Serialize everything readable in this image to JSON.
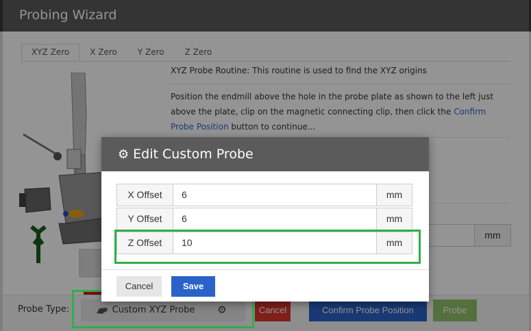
{
  "main_modal": {
    "title": "Probing Wizard",
    "tabs": [
      "XYZ Zero",
      "X Zero",
      "Y Zero",
      "Z Zero"
    ],
    "active_tab": "XYZ Zero",
    "intro": "XYZ Probe Routine: This routine is used to find the XYZ origins",
    "instructions": {
      "before_link": "Position the endmill above the hole in the probe plate as shown to the left just above the plate, clip on the magnetic connecting clip, then click the ",
      "link": "Confirm Probe Position",
      "after_link": " button to continue..."
    },
    "background_unit": "mm"
  },
  "footer": {
    "probe_type_label": "Probe Type:",
    "probe_select_label": "Custom XYZ Probe",
    "cancel_label": "Cancel",
    "confirm_label": "Confirm Probe Position",
    "probe_label": "Probe"
  },
  "dialog": {
    "title": "Edit Custom Probe",
    "rows": [
      {
        "label": "X Offset",
        "value": "6",
        "unit": "mm"
      },
      {
        "label": "Y Offset",
        "value": "6",
        "unit": "mm"
      },
      {
        "label": "Z Offset",
        "value": "10",
        "unit": "mm"
      }
    ],
    "cancel_label": "Cancel",
    "save_label": "Save"
  },
  "colors": {
    "header": "#5b5b5b",
    "primary": "#2a62c9",
    "danger": "#d9362b",
    "success": "#8fc16a",
    "highlight": "#2fae4a"
  },
  "icons": {
    "gears": "gears-icon",
    "probe": "probe-icon"
  }
}
